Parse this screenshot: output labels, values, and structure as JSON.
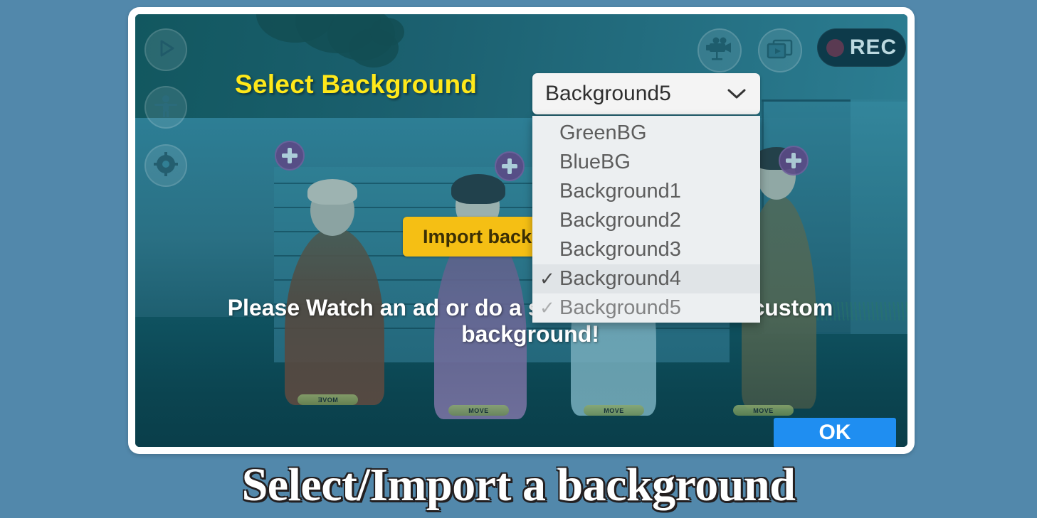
{
  "caption": "Select/Import a background",
  "screen": {
    "title": "Select Background",
    "import_button_label": "Import background",
    "ad_notice": "Please Watch an ad or do a servey to import the custom background!",
    "ok_button_label": "OK",
    "rec_label": "REC"
  },
  "dropdown": {
    "selected_value": "Background5",
    "chevron_icon": "chevron-down-icon",
    "options": [
      {
        "label": "GreenBG",
        "checked": false,
        "state": "normal"
      },
      {
        "label": "BlueBG",
        "checked": false,
        "state": "normal"
      },
      {
        "label": "Background1",
        "checked": false,
        "state": "normal"
      },
      {
        "label": "Background2",
        "checked": false,
        "state": "normal"
      },
      {
        "label": "Background3",
        "checked": false,
        "state": "normal"
      },
      {
        "label": "Background4",
        "checked": true,
        "state": "selected"
      },
      {
        "label": "Background5",
        "checked": true,
        "state": "fading"
      }
    ]
  },
  "toolbar_left": [
    {
      "name": "play-icon",
      "label": "Play"
    },
    {
      "name": "character-icon",
      "label": "Character"
    },
    {
      "name": "settings-gear-icon",
      "label": "Settings"
    }
  ],
  "toolbar_top_right": [
    {
      "name": "movie-camera-icon",
      "label": "Camera"
    },
    {
      "name": "frames-icon",
      "label": "Frames"
    }
  ],
  "characters": [
    {
      "move_label": "MOVE",
      "flipped": true
    },
    {
      "move_label": "MOVE",
      "flipped": false
    },
    {
      "move_label": "MOVE",
      "flipped": false
    },
    {
      "move_label": "MOVE",
      "flipped": false
    }
  ],
  "add_badges": [
    {
      "name": "add-character-plus-icon"
    },
    {
      "name": "add-character-plus-icon"
    },
    {
      "name": "add-character-plus-icon"
    }
  ],
  "colors": {
    "page_background": "#5288ab",
    "title_yellow": "#ffe81a",
    "import_button_yellow": "#f5bf14",
    "ok_button_blue": "#1f8ef1",
    "rec_background": "#0d3a4a",
    "scene_teal": "#2d7e95",
    "dropdown_background": "#eceff1"
  }
}
